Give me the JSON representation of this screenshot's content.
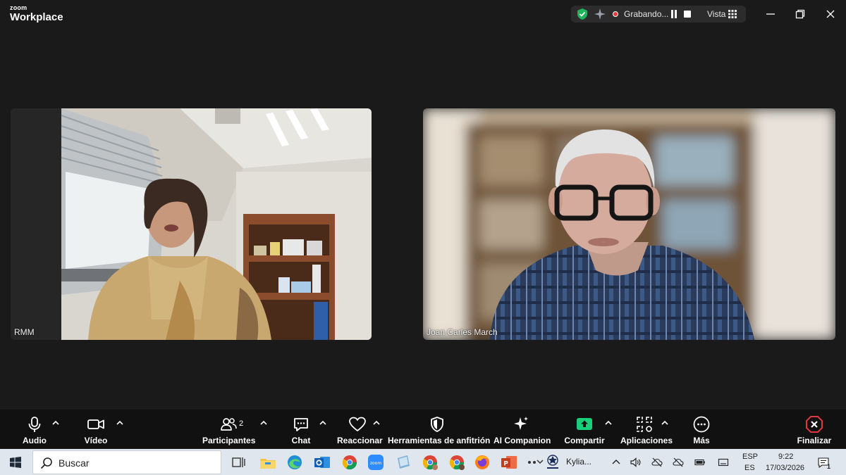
{
  "app": {
    "logo_top": "zoom",
    "logo_bottom": "Workplace"
  },
  "status_pill": {
    "recording_text": "Grabando...",
    "view_label": "Vista"
  },
  "participants": [
    {
      "name": "RMM"
    },
    {
      "name": "Joan Carles March"
    }
  ],
  "toolbar": {
    "audio": "Audio",
    "video": "Vídeo",
    "participants": "Participantes",
    "participants_count": "2",
    "chat": "Chat",
    "react": "Reaccionar",
    "host_tools": "Herramientas de anfitrión",
    "ai_companion": "AI Companion",
    "share": "Compartir",
    "apps": "Aplicaciones",
    "more": "Más",
    "end": "Finalizar"
  },
  "taskbar": {
    "search_placeholder": "Buscar",
    "media_title": "Kylia...",
    "lang_top": "ESP",
    "lang_bottom": "ES",
    "time": "9:22",
    "date": "17/03/2026",
    "notification_count": "1"
  },
  "colors": {
    "background": "#1a1a1a",
    "toolbar": "#111111",
    "recording": "#e8393b",
    "share_green": "#17d17a",
    "end_red": "#e0383e",
    "taskbar": "#dfe6ee"
  }
}
